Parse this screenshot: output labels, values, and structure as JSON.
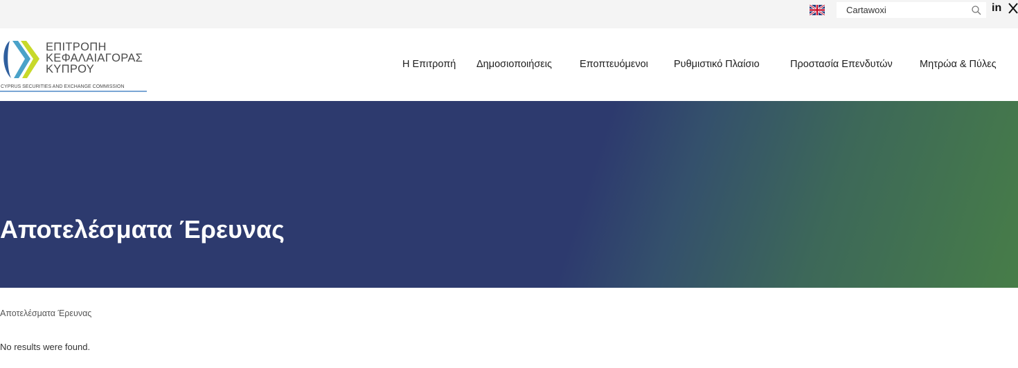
{
  "topbar": {
    "language_flag": "uk-flag-icon",
    "search": {
      "value": "Cartawoxi",
      "placeholder": ""
    },
    "social": {
      "linkedin_label": "in"
    }
  },
  "header": {
    "logo": {
      "line1": "ΕΠΙΤΡΟΠΗ",
      "line2": "ΚΕΦΑΛΑΙΑΓΟΡΑΣ",
      "line3": "ΚΥΠΡΟΥ",
      "subtitle": "CYPRUS SECURITIES AND EXCHANGE COMMISSION"
    },
    "nav": [
      {
        "label": "Η Επιτροπή"
      },
      {
        "label": "Δημοσιοποιήσεις"
      },
      {
        "label": "Εποπτευόμενοι"
      },
      {
        "label": "Ρυθμιστικό Πλαίσιο"
      },
      {
        "label": "Προστασία Επενδυτών"
      },
      {
        "label": "Μητρώα & Πύλες"
      }
    ]
  },
  "hero": {
    "title": "Αποτελέσματα Έρευνας"
  },
  "content": {
    "breadcrumb": "Αποτελέσματα Έρευνας",
    "message": "No results were found."
  },
  "colors": {
    "hero_blue": "#2d3a6e",
    "hero_green": "#477d48",
    "topbar_bg": "#f4f4f4",
    "logo_blue": "#2f5f9e",
    "logo_green": "#c8d92a"
  }
}
